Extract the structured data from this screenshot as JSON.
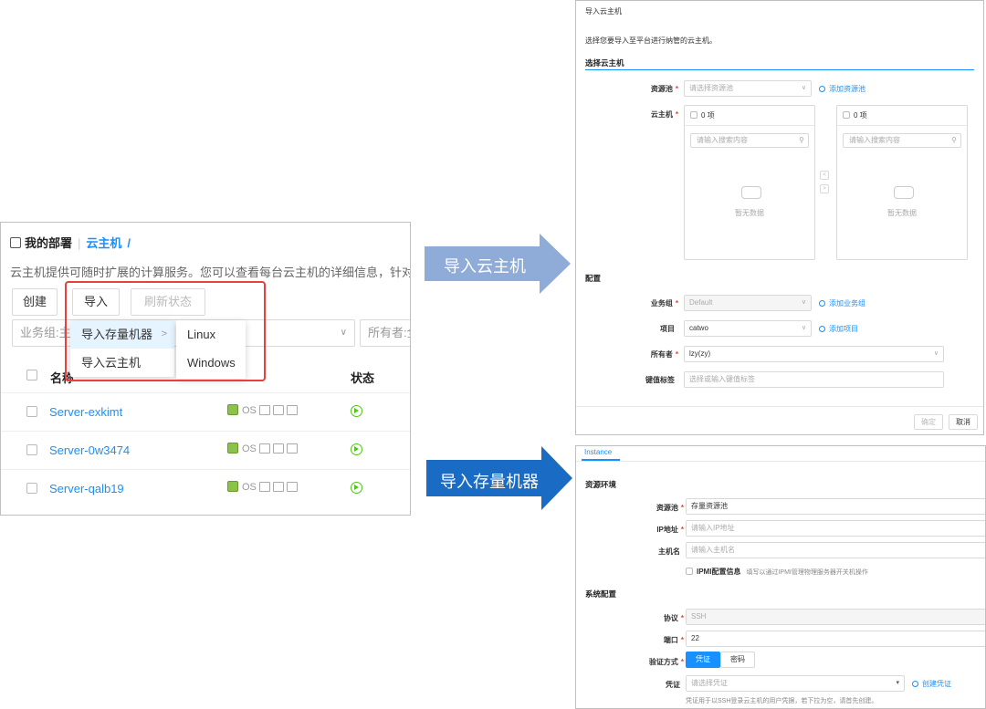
{
  "left_panel": {
    "header": {
      "title": "我的部署",
      "breadcrumb": "云主机",
      "slash": "/"
    },
    "description": "云主机提供可随时扩展的计算服务。您可以查看每台云主机的详细信息，针对",
    "toolbar": {
      "create_label": "创建",
      "import_label": "导入",
      "refresh_label": "刷新状态"
    },
    "filters": {
      "group_placeholder": "业务组:主",
      "owner_placeholder": "所有者:全"
    },
    "import_menu": {
      "items": [
        {
          "label": "导入存量机器",
          "arrow": ">"
        },
        {
          "label": "导入云主机"
        }
      ],
      "submenu": [
        "Linux",
        "Windows"
      ]
    },
    "table": {
      "columns": {
        "name": "名称",
        "status": "状态"
      },
      "rows": [
        {
          "name": "Server-exkimt",
          "os": "OS"
        },
        {
          "name": "Server-0w3474",
          "os": "OS"
        },
        {
          "name": "Server-qalb19",
          "os": "OS"
        }
      ]
    },
    "colors": {
      "link": "#1890ff",
      "highlight": "#e8403c",
      "running": "#52c41a"
    }
  },
  "arrows": {
    "import_vm": {
      "label": "导入云主机",
      "color": "#8fabd8"
    },
    "import_existing": {
      "label": "导入存量机器",
      "color": "#1a6bc4"
    }
  },
  "import_vm_dialog": {
    "title": "导入云主机",
    "description": "选择您要导入至平台进行纳管的云主机。",
    "section_select": "选择云主机",
    "resource_pool": {
      "label": "资源池",
      "placeholder": "请选择资源池",
      "link": "添加资源池"
    },
    "vm": {
      "label": "云主机",
      "left_count": "0 项",
      "right_count": "0 项",
      "search_placeholder": "请输入搜索内容",
      "empty": "暂无数据"
    },
    "section_config": "配置",
    "business_group": {
      "label": "业务组",
      "value": "Default",
      "link": "添加业务组"
    },
    "project": {
      "label": "项目",
      "value": "catwo",
      "link": "添加项目"
    },
    "owner": {
      "label": "所有者",
      "value": "lzy(zy)"
    },
    "tags": {
      "label": "键值标签",
      "placeholder": "选择或输入键值标签"
    },
    "buttons": {
      "confirm": "确定",
      "cancel": "取消"
    }
  },
  "import_existing_dialog": {
    "tab": "Instance",
    "section_env": "资源环境",
    "resource_pool": {
      "label": "资源池",
      "value": "存量资源池"
    },
    "ip": {
      "label": "IP地址",
      "placeholder": "请输入IP地址"
    },
    "hostname": {
      "label": "主机名",
      "placeholder": "请输入主机名"
    },
    "ipmi": {
      "label": "IPMI配置信息",
      "hint": "填写以通过IPMI管理物理服务器开关机操作"
    },
    "section_system": "系统配置",
    "protocol": {
      "label": "协议",
      "value": "SSH"
    },
    "port": {
      "label": "端口",
      "value": "22"
    },
    "auth": {
      "label": "验证方式",
      "options": [
        "凭证",
        "密码"
      ]
    },
    "credential": {
      "label": "凭证",
      "placeholder": "请选择凭证",
      "link": "创建凭证",
      "hint": "凭证用于以SSH登录云主机的用户凭据，若下拉为空，请首先创建。"
    }
  }
}
